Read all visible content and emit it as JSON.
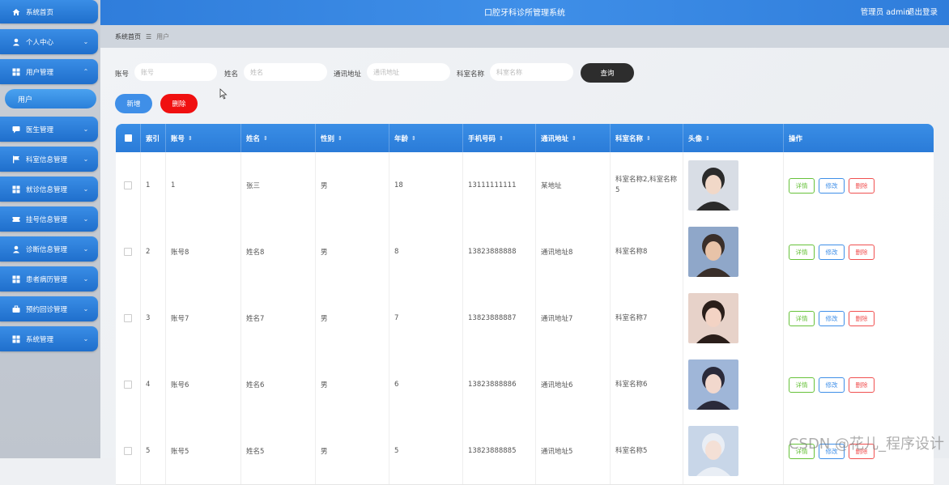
{
  "sidebar": {
    "items": [
      {
        "label": "系统首页",
        "icon": "home-icon"
      },
      {
        "label": "个人中心",
        "icon": "user-icon"
      },
      {
        "label": "用户管理",
        "icon": "grid-icon"
      },
      {
        "label": "医生管理",
        "icon": "chat-icon"
      },
      {
        "label": "科室信息管理",
        "icon": "flag-icon"
      },
      {
        "label": "就诊信息管理",
        "icon": "grid-icon"
      },
      {
        "label": "挂号信息管理",
        "icon": "ticket-icon"
      },
      {
        "label": "诊断信息管理",
        "icon": "user-icon"
      },
      {
        "label": "患者病历管理",
        "icon": "grid-icon"
      },
      {
        "label": "预约回诊管理",
        "icon": "briefcase-icon"
      },
      {
        "label": "系统管理",
        "icon": "grid-icon"
      }
    ],
    "sub_active": "用户"
  },
  "header": {
    "title": "口腔牙科诊所管理系统",
    "user": "管理员 admin",
    "logout": "退出登录"
  },
  "breadcrumb": {
    "home": "系统首页",
    "current": "用户"
  },
  "search": {
    "account_label": "账号",
    "account_placeholder": "账号",
    "name_label": "姓名",
    "name_placeholder": "姓名",
    "address_label": "通讯地址",
    "address_placeholder": "通讯地址",
    "dept_label": "科室名称",
    "dept_placeholder": "科室名称",
    "query_button": "查询"
  },
  "actions": {
    "add": "新增",
    "delete": "删除"
  },
  "table": {
    "headers": [
      "索引",
      "账号",
      "姓名",
      "性别",
      "年龄",
      "手机号码",
      "通讯地址",
      "科室名称",
      "头像",
      "操作"
    ],
    "rows": [
      {
        "index": "1",
        "account": "1",
        "name": "张三",
        "gender": "男",
        "age": "18",
        "phone": "13111111111",
        "address": "某地址",
        "dept": "科室名称2,科室名称5"
      },
      {
        "index": "2",
        "account": "账号8",
        "name": "姓名8",
        "gender": "男",
        "age": "8",
        "phone": "13823888888",
        "address": "通讯地址8",
        "dept": "科室名称8"
      },
      {
        "index": "3",
        "account": "账号7",
        "name": "姓名7",
        "gender": "男",
        "age": "7",
        "phone": "13823888887",
        "address": "通讯地址7",
        "dept": "科室名称7"
      },
      {
        "index": "4",
        "account": "账号6",
        "name": "姓名6",
        "gender": "男",
        "age": "6",
        "phone": "13823888886",
        "address": "通讯地址6",
        "dept": "科室名称6"
      },
      {
        "index": "5",
        "account": "账号5",
        "name": "姓名5",
        "gender": "男",
        "age": "5",
        "phone": "13823888885",
        "address": "通讯地址5",
        "dept": "科室名称5"
      }
    ],
    "op_detail": "详情",
    "op_edit": "修改",
    "op_delete": "删除"
  },
  "watermark": "CSDN @花儿_程序设计",
  "colors": {
    "primary": "#3f8fe8",
    "danger": "#f01010",
    "dark": "#2d2d2d"
  }
}
